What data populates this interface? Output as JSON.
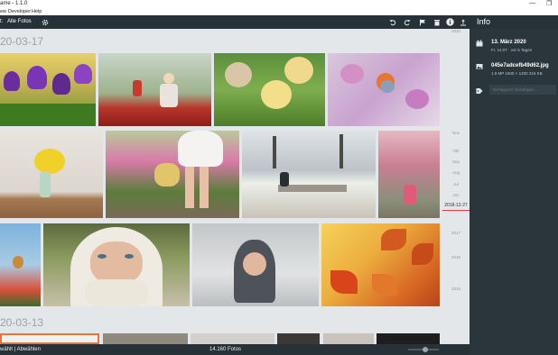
{
  "window": {
    "title": "ame - 1.1.0",
    "minimize": "—",
    "restore": "❐"
  },
  "menu": {
    "view": "ew",
    "developer": "Developer",
    "help": "Help"
  },
  "toolbar": {
    "filter_label": "Alle Fotos",
    "filter_prefix": "t:"
  },
  "sections": [
    {
      "date": "20-03-17"
    },
    {
      "date": "20-03-13"
    }
  ],
  "scrubber": {
    "labels": [
      "2020",
      "Nov",
      "Okt",
      "Sep",
      "Aug",
      "Jul",
      "Jun"
    ],
    "current": "2018-12-27",
    "years": [
      "2017",
      "2016",
      "2015"
    ]
  },
  "info": {
    "title": "Info",
    "date_main": "13. März 2020",
    "date_sub": "Fr. 14:07 · vor 6 Tagen",
    "file_name": "045e7adcefb49d62.jpg",
    "file_meta": "1.9 MP      1600 × 1200      316 KB",
    "tag_placeholder": "Schlagwort hinzufügen..."
  },
  "status": {
    "left": "wählt | Abwählen",
    "count": "14.160 Fotos"
  },
  "colors": {
    "toolbar": "#263238",
    "panel": "#2b363c",
    "background": "#e3e7e9",
    "accent": "#e53935",
    "selection": "#e8743b"
  },
  "icons": [
    "gear-icon",
    "rotate-left-icon",
    "rotate-right-icon",
    "flag-icon",
    "trash-icon",
    "info-icon",
    "share-icon",
    "calendar-icon",
    "image-icon",
    "tag-icon"
  ]
}
